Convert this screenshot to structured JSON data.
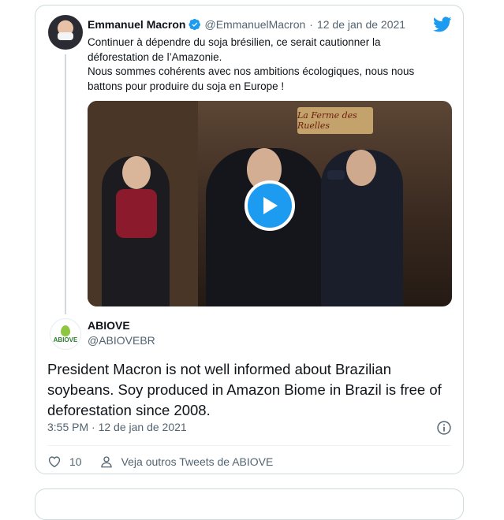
{
  "tweet": {
    "author_name": "Emmanuel Macron",
    "author_handle": "@EmmanuelMacron",
    "separator": "·",
    "date": "12 de jan de 2021",
    "lines": [
      "Continuer à dépendre du soja brésilien, ce serait cautionner la",
      "déforestation de l’Amazonie.",
      "Nous sommes cohérents avec nos ambitions écologiques, nous nous",
      "battons pour produire du soja en Europe !"
    ],
    "video_sign": "La Ferme des Ruelles"
  },
  "quoted": {
    "author_name": "ABIOVE",
    "author_handle": "@ABIOVEBR",
    "avatar_text": "ABIOVE",
    "text": "President Macron is not well informed about Brazilian soybeans. Soy produced in Amazon Biome in Brazil is free of deforestation since 2008.",
    "time": "3:55 PM",
    "separator": "·",
    "date": "12 de jan de 2021"
  },
  "actions": {
    "like_count": "10",
    "profile_link": "Veja outros Tweets de ABIOVE"
  },
  "colors": {
    "twitter_blue": "#1d9bf0",
    "secondary_text": "#536471",
    "border": "#cfd9de"
  },
  "icons": [
    "verified-badge-icon",
    "twitter-bird-icon",
    "play-icon",
    "info-icon",
    "heart-icon",
    "user-icon"
  ]
}
